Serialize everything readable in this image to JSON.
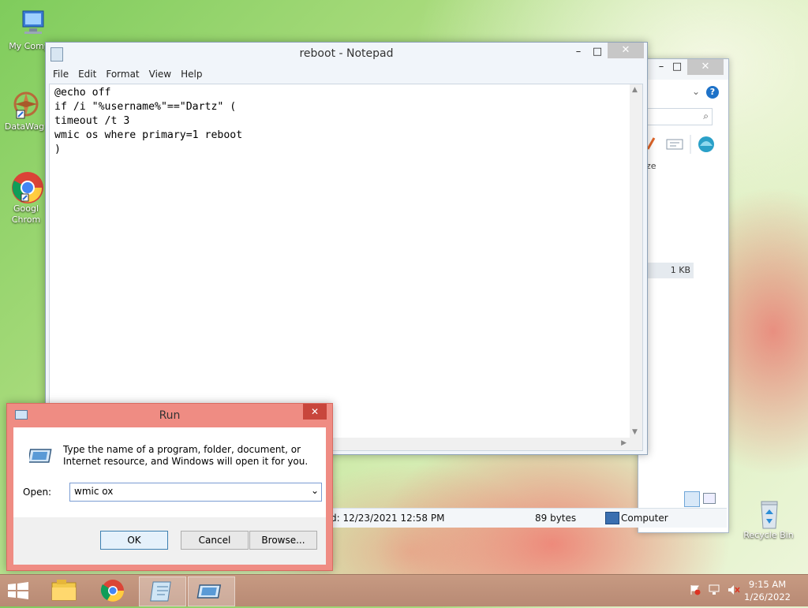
{
  "desktop": {
    "icons": [
      {
        "label": "My Comp"
      },
      {
        "label": "DataWag"
      },
      {
        "label": "Googl Chrom"
      },
      {
        "label": "Recycle Bin"
      }
    ]
  },
  "notepad": {
    "title": "reboot - Notepad",
    "menu": [
      "File",
      "Edit",
      "Format",
      "View",
      "Help"
    ],
    "content": "@echo off\nif /i \"%username%\"==\"Dartz\" (\ntimeout /t 3\nwmic os where primary=1 reboot\n)",
    "minimize": "–",
    "maximize": "□",
    "close": "✕"
  },
  "explorer": {
    "column_fragment": "ze",
    "file_size": "1 KB",
    "status_modified": "d: 12/23/2021 12:58 PM",
    "status_size": "89 bytes",
    "status_location": "Computer"
  },
  "run": {
    "title": "Run",
    "description": "Type the name of a program, folder, document, or Internet resource, and Windows will open it for you.",
    "open_label": "Open:",
    "input_value": "wmic ox",
    "ok_label": "OK",
    "cancel_label": "Cancel",
    "browse_label": "Browse..."
  },
  "taskbar": {
    "time": "9:15 AM",
    "date": "1/26/2022"
  },
  "colors": {
    "run_frame": "#ef8c83",
    "taskbar": "#c79a82"
  }
}
